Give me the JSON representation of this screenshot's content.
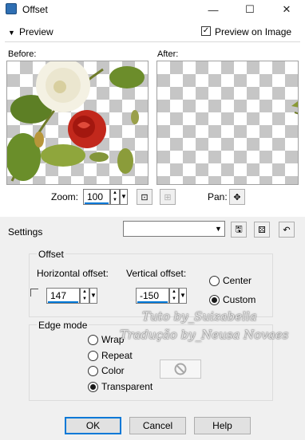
{
  "window": {
    "title": "Offset",
    "minimize_glyph": "—",
    "maximize_glyph": "☐",
    "close_glyph": "✕"
  },
  "preview": {
    "toggle_label": "Preview",
    "preview_on_image_label": "Preview on Image",
    "preview_on_image_checked": true,
    "before_label": "Before:",
    "after_label": "After:",
    "zoom_label": "Zoom:",
    "zoom_value": "100",
    "pan_label": "Pan:"
  },
  "settings": {
    "label": "Settings",
    "preset_value": ""
  },
  "offset": {
    "group_label": "Offset",
    "horizontal_label": "Horizontal offset:",
    "horizontal_value": "147",
    "vertical_label": "Vertical offset:",
    "vertical_value": "-150",
    "center_label": "Center",
    "custom_label": "Custom",
    "selected": "Custom"
  },
  "edge_mode": {
    "group_label": "Edge mode",
    "options": [
      "Wrap",
      "Repeat",
      "Color",
      "Transparent"
    ],
    "selected": "Transparent"
  },
  "watermark": {
    "line1": "Tuto by_Suizabella",
    "line2": "Tradução by_Neusa Novaes"
  },
  "buttons": {
    "ok": "OK",
    "cancel": "Cancel",
    "help": "Help"
  },
  "colors": {
    "accent": "#0078d7",
    "checker": "#c6c6c6",
    "dialog_bg": "#f0f0f0"
  }
}
